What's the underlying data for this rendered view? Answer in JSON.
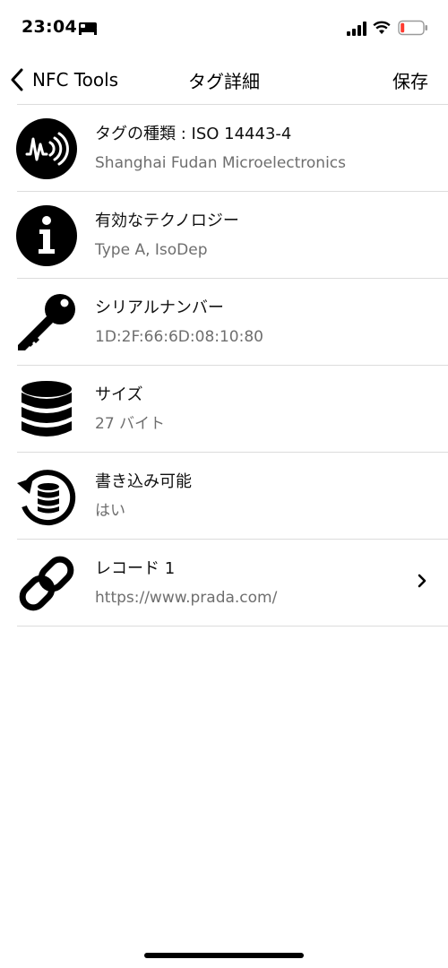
{
  "status_bar": {
    "time": "23:04",
    "icons": [
      "sleep-icon",
      "signal-icon",
      "wifi-icon",
      "battery-low-icon"
    ],
    "battery_color": "#ff3b30"
  },
  "nav": {
    "back_label": "NFC Tools",
    "title": "タグ詳細",
    "save_label": "保存"
  },
  "rows": [
    {
      "icon": "nfc-tag-icon",
      "title": "タグの種類 : ISO 14443-4",
      "subtitle": "Shanghai Fudan Microelectronics"
    },
    {
      "icon": "info-icon",
      "title": "有効なテクノロジー",
      "subtitle": "Type A, IsoDep"
    },
    {
      "icon": "key-icon",
      "title": "シリアルナンバー",
      "subtitle": "1D:2F:66:6D:08:10:80"
    },
    {
      "icon": "database-icon",
      "title": "サイズ",
      "subtitle": "27 バイト"
    },
    {
      "icon": "writable-icon",
      "title": "書き込み可能",
      "subtitle": "はい"
    },
    {
      "icon": "link-icon",
      "title": "レコード 1",
      "subtitle": "https://www.prada.com/",
      "chevron": "chevron-right-icon"
    }
  ]
}
